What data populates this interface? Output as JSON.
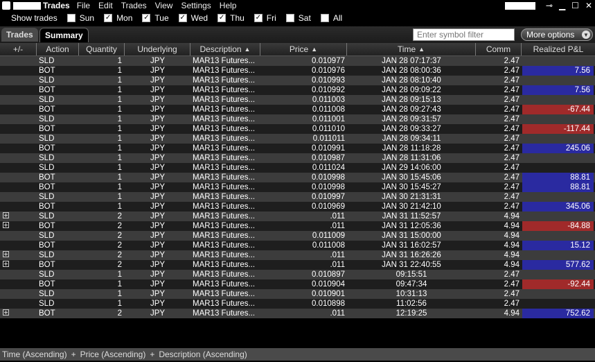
{
  "window": {
    "title": "Trades",
    "menu": [
      "File",
      "Edit",
      "Trades",
      "View",
      "Settings",
      "Help"
    ],
    "controls": [
      "pin-icon",
      "minimize-icon",
      "maximize-icon",
      "close-icon"
    ]
  },
  "show_trades": {
    "label": "Show trades",
    "days": [
      {
        "label": "Sun",
        "checked": false
      },
      {
        "label": "Mon",
        "checked": true
      },
      {
        "label": "Tue",
        "checked": true
      },
      {
        "label": "Wed",
        "checked": true
      },
      {
        "label": "Thu",
        "checked": true
      },
      {
        "label": "Fri",
        "checked": true
      },
      {
        "label": "Sat",
        "checked": false
      },
      {
        "label": "All",
        "checked": false
      }
    ]
  },
  "tabs": [
    "Trades",
    "Summary"
  ],
  "filter": {
    "placeholder": "Enter symbol filter"
  },
  "more_options": "More options",
  "columns": [
    "+/-",
    "Action",
    "Quantity",
    "Underlying",
    "Description",
    "Price",
    "Time",
    "Comm",
    "Realized P&L"
  ],
  "rows": [
    {
      "expand": false,
      "action": "SLD",
      "qty": "1",
      "und": "JPY",
      "desc": "MAR13 Futures...",
      "price": "0.010977",
      "time": "JAN 28 07:17:37",
      "comm": "2.47",
      "pnl": ""
    },
    {
      "expand": false,
      "action": "BOT",
      "qty": "1",
      "und": "JPY",
      "desc": "MAR13 Futures...",
      "price": "0.010976",
      "time": "JAN 28 08:00:36",
      "comm": "2.47",
      "pnl": "7.56"
    },
    {
      "expand": false,
      "action": "SLD",
      "qty": "1",
      "und": "JPY",
      "desc": "MAR13 Futures...",
      "price": "0.010993",
      "time": "JAN 28 08:10:40",
      "comm": "2.47",
      "pnl": ""
    },
    {
      "expand": false,
      "action": "BOT",
      "qty": "1",
      "und": "JPY",
      "desc": "MAR13 Futures...",
      "price": "0.010992",
      "time": "JAN 28 09:09:22",
      "comm": "2.47",
      "pnl": "7.56"
    },
    {
      "expand": false,
      "action": "SLD",
      "qty": "1",
      "und": "JPY",
      "desc": "MAR13 Futures...",
      "price": "0.011003",
      "time": "JAN 28 09:15:13",
      "comm": "2.47",
      "pnl": ""
    },
    {
      "expand": false,
      "action": "BOT",
      "qty": "1",
      "und": "JPY",
      "desc": "MAR13 Futures...",
      "price": "0.011008",
      "time": "JAN 28 09:27:43",
      "comm": "2.47",
      "pnl": "-67.44"
    },
    {
      "expand": false,
      "action": "SLD",
      "qty": "1",
      "und": "JPY",
      "desc": "MAR13 Futures...",
      "price": "0.011001",
      "time": "JAN 28 09:31:57",
      "comm": "2.47",
      "pnl": ""
    },
    {
      "expand": false,
      "action": "BOT",
      "qty": "1",
      "und": "JPY",
      "desc": "MAR13 Futures...",
      "price": "0.011010",
      "time": "JAN 28 09:33:27",
      "comm": "2.47",
      "pnl": "-117.44"
    },
    {
      "expand": false,
      "action": "SLD",
      "qty": "1",
      "und": "JPY",
      "desc": "MAR13 Futures...",
      "price": "0.011011",
      "time": "JAN 28 09:34:11",
      "comm": "2.47",
      "pnl": ""
    },
    {
      "expand": false,
      "action": "BOT",
      "qty": "1",
      "und": "JPY",
      "desc": "MAR13 Futures...",
      "price": "0.010991",
      "time": "JAN 28 11:18:28",
      "comm": "2.47",
      "pnl": "245.06"
    },
    {
      "expand": false,
      "action": "SLD",
      "qty": "1",
      "und": "JPY",
      "desc": "MAR13 Futures...",
      "price": "0.010987",
      "time": "JAN 28 11:31:06",
      "comm": "2.47",
      "pnl": ""
    },
    {
      "expand": false,
      "action": "SLD",
      "qty": "1",
      "und": "JPY",
      "desc": "MAR13 Futures...",
      "price": "0.011024",
      "time": "JAN 29 14:06:00",
      "comm": "2.47",
      "pnl": ""
    },
    {
      "expand": false,
      "action": "BOT",
      "qty": "1",
      "und": "JPY",
      "desc": "MAR13 Futures...",
      "price": "0.010998",
      "time": "JAN 30 15:45:06",
      "comm": "2.47",
      "pnl": "88.81"
    },
    {
      "expand": false,
      "action": "BOT",
      "qty": "1",
      "und": "JPY",
      "desc": "MAR13 Futures...",
      "price": "0.010998",
      "time": "JAN 30 15:45:27",
      "comm": "2.47",
      "pnl": "88.81"
    },
    {
      "expand": false,
      "action": "SLD",
      "qty": "1",
      "und": "JPY",
      "desc": "MAR13 Futures...",
      "price": "0.010997",
      "time": "JAN 30 21:31:31",
      "comm": "2.47",
      "pnl": ""
    },
    {
      "expand": false,
      "action": "BOT",
      "qty": "1",
      "und": "JPY",
      "desc": "MAR13 Futures...",
      "price": "0.010969",
      "time": "JAN 30 21:42:10",
      "comm": "2.47",
      "pnl": "345.06"
    },
    {
      "expand": true,
      "action": "SLD",
      "qty": "2",
      "und": "JPY",
      "desc": "MAR13 Futures...",
      "price": ".011",
      "time": "JAN 31 11:52:57",
      "comm": "4.94",
      "pnl": ""
    },
    {
      "expand": true,
      "action": "BOT",
      "qty": "2",
      "und": "JPY",
      "desc": "MAR13 Futures...",
      "price": ".011",
      "time": "JAN 31 12:05:36",
      "comm": "4.94",
      "pnl": "-84.88"
    },
    {
      "expand": false,
      "action": "SLD",
      "qty": "2",
      "und": "JPY",
      "desc": "MAR13 Futures...",
      "price": "0.011009",
      "time": "JAN 31 15:00:00",
      "comm": "4.94",
      "pnl": ""
    },
    {
      "expand": false,
      "action": "BOT",
      "qty": "2",
      "und": "JPY",
      "desc": "MAR13 Futures...",
      "price": "0.011008",
      "time": "JAN 31 16:02:57",
      "comm": "4.94",
      "pnl": "15.12"
    },
    {
      "expand": true,
      "action": "SLD",
      "qty": "2",
      "und": "JPY",
      "desc": "MAR13 Futures...",
      "price": ".011",
      "time": "JAN 31 16:26:26",
      "comm": "4.94",
      "pnl": ""
    },
    {
      "expand": true,
      "action": "BOT",
      "qty": "2",
      "und": "JPY",
      "desc": "MAR13 Futures...",
      "price": ".011",
      "time": "JAN 31 22:40:55",
      "comm": "4.94",
      "pnl": "577.62"
    },
    {
      "expand": false,
      "action": "SLD",
      "qty": "1",
      "und": "JPY",
      "desc": "MAR13 Futures...",
      "price": "0.010897",
      "time": "09:15:51",
      "comm": "2.47",
      "pnl": ""
    },
    {
      "expand": false,
      "action": "BOT",
      "qty": "1",
      "und": "JPY",
      "desc": "MAR13 Futures...",
      "price": "0.010904",
      "time": "09:47:34",
      "comm": "2.47",
      "pnl": "-92.44"
    },
    {
      "expand": false,
      "action": "SLD",
      "qty": "1",
      "und": "JPY",
      "desc": "MAR13 Futures...",
      "price": "0.010901",
      "time": "10:31:13",
      "comm": "2.47",
      "pnl": ""
    },
    {
      "expand": false,
      "action": "SLD",
      "qty": "1",
      "und": "JPY",
      "desc": "MAR13 Futures...",
      "price": "0.010898",
      "time": "11:02:56",
      "comm": "2.47",
      "pnl": ""
    },
    {
      "expand": true,
      "action": "BOT",
      "qty": "2",
      "und": "JPY",
      "desc": "MAR13 Futures...",
      "price": ".011",
      "time": "12:19:25",
      "comm": "4.94",
      "pnl": "752.62"
    }
  ],
  "footer": {
    "sorts": [
      "Time (Ascending)",
      "Price (Ascending)",
      "Description (Ascending)"
    ],
    "separator": "+"
  },
  "colors": {
    "positive_pnl": "#2a2aa0",
    "negative_pnl": "#a02a2a",
    "row_light": "#3c3c3c",
    "row_dark": "#1e1e1e"
  }
}
